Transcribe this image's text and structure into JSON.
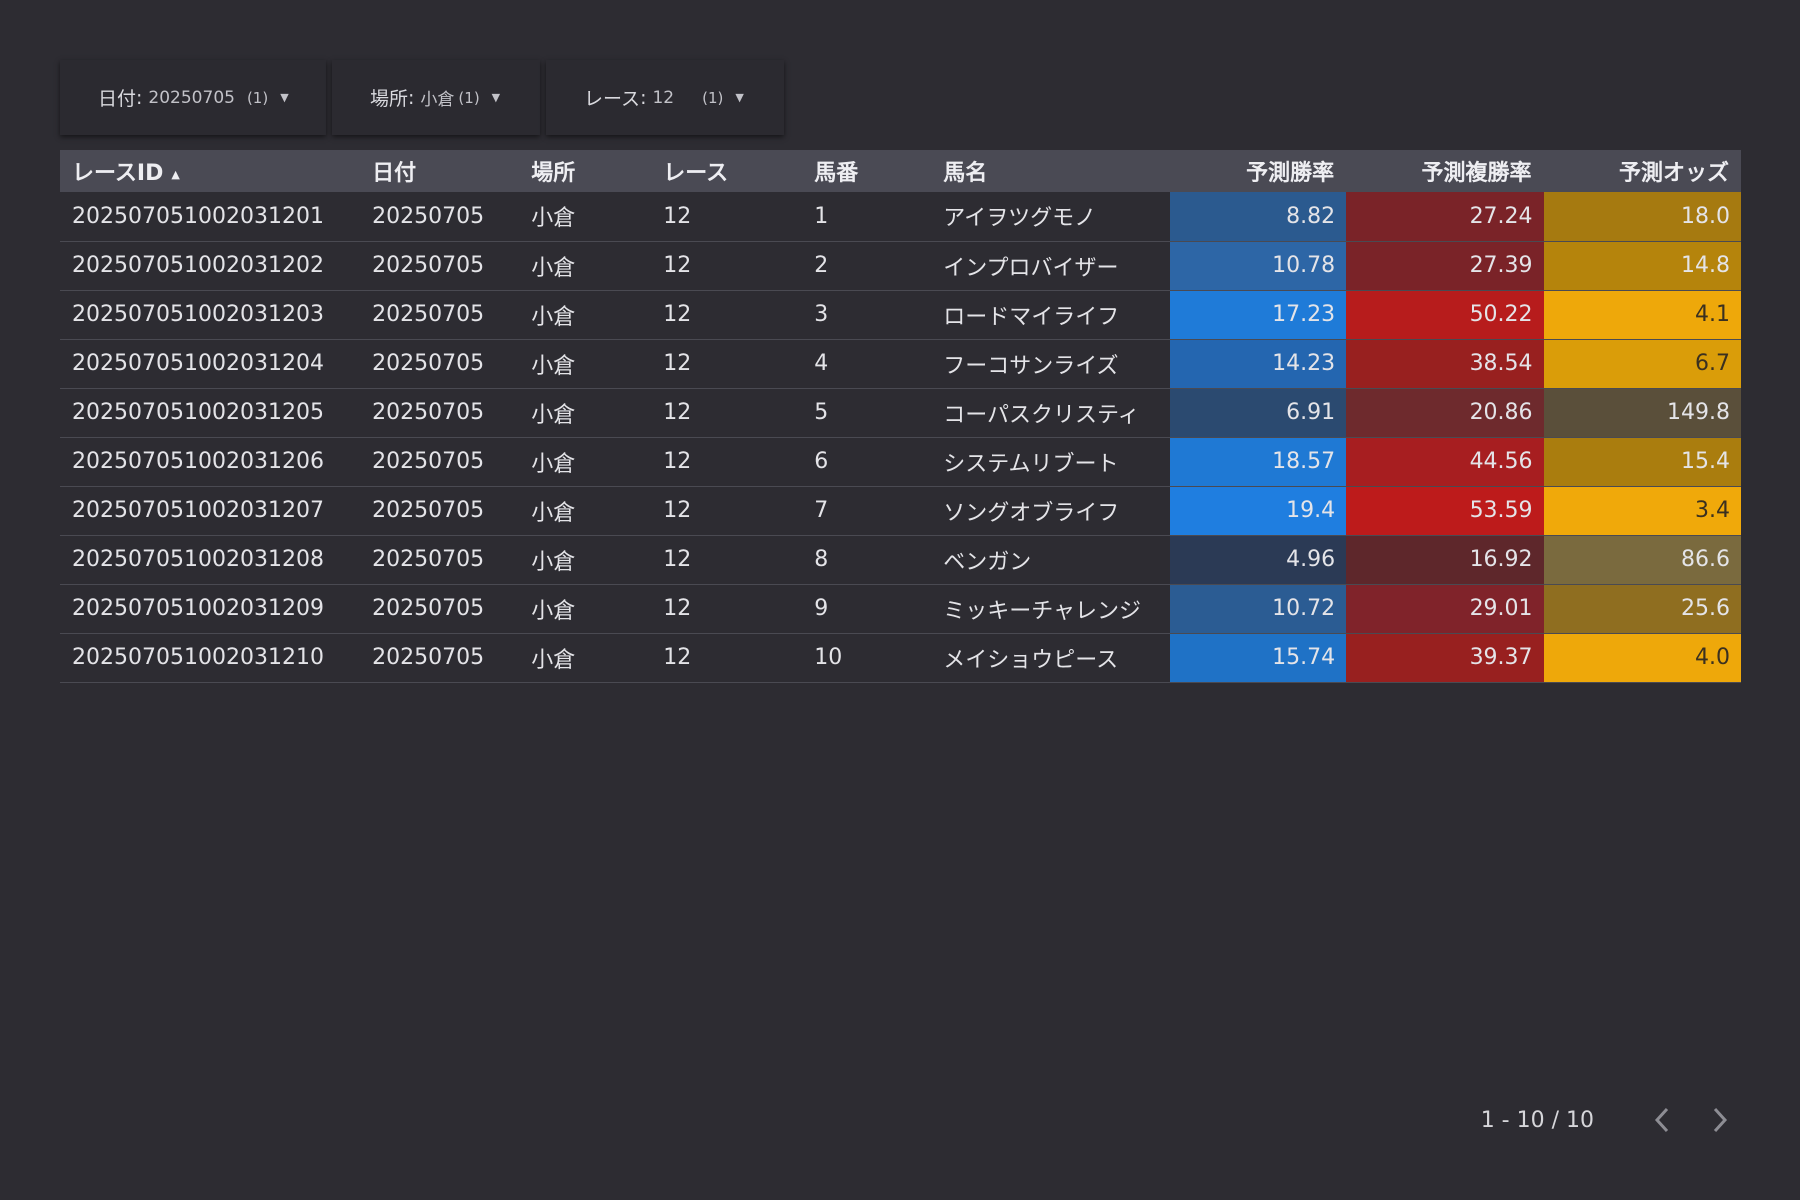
{
  "filters": [
    {
      "label": "日付",
      "value": "20250705",
      "count": "(1)"
    },
    {
      "label": "場所",
      "value": "小倉",
      "count": "(1)"
    },
    {
      "label": "レース",
      "value": "12",
      "count": "(1)"
    }
  ],
  "table": {
    "columns": [
      "レースID",
      "日付",
      "場所",
      "レース",
      "馬番",
      "馬名",
      "予測勝率",
      "予測複勝率",
      "予測オッズ"
    ],
    "sort_column": "レースID",
    "sort_direction": "ascending",
    "rows": [
      [
        "202507051002031201",
        "20250705",
        "小倉",
        "12",
        "1",
        "アイヲツグモノ",
        "8.82",
        "27.24",
        "18.0"
      ],
      [
        "202507051002031202",
        "20250705",
        "小倉",
        "12",
        "2",
        "インプロバイザー",
        "10.78",
        "27.39",
        "14.8"
      ],
      [
        "202507051002031203",
        "20250705",
        "小倉",
        "12",
        "3",
        "ロードマイライフ",
        "17.23",
        "50.22",
        "4.1"
      ],
      [
        "202507051002031204",
        "20250705",
        "小倉",
        "12",
        "4",
        "フーコサンライズ",
        "14.23",
        "38.54",
        "6.7"
      ],
      [
        "202507051002031205",
        "20250705",
        "小倉",
        "12",
        "5",
        "コーパスクリスティ",
        "6.91",
        "20.86",
        "149.8"
      ],
      [
        "202507051002031206",
        "20250705",
        "小倉",
        "12",
        "6",
        "システムリブート",
        "18.57",
        "44.56",
        "15.4"
      ],
      [
        "202507051002031207",
        "20250705",
        "小倉",
        "12",
        "7",
        "ソングオブライフ",
        "19.4",
        "53.59",
        "3.4"
      ],
      [
        "202507051002031208",
        "20250705",
        "小倉",
        "12",
        "8",
        "ベンガン",
        "4.96",
        "16.92",
        "86.6"
      ],
      [
        "202507051002031209",
        "20250705",
        "小倉",
        "12",
        "9",
        "ミッキーチャレンジ",
        "10.72",
        "29.01",
        "25.6"
      ],
      [
        "202507051002031210",
        "20250705",
        "小倉",
        "12",
        "10",
        "メイショウピース",
        "15.74",
        "39.37",
        "4.0"
      ]
    ],
    "cell_colors": {
      "win": [
        "#2b5a8f",
        "#2d66a6",
        "#1f7bd8",
        "#2466b0",
        "#2b4a70",
        "#1f79d4",
        "#1f7ee0",
        "#2b3a55",
        "#2b5c93",
        "#1f72c6"
      ],
      "place": [
        "#7a2328",
        "#7a2328",
        "#b71c1c",
        "#98201f",
        "#6e2a2d",
        "#a71e20",
        "#bd1b1b",
        "#5e272b",
        "#80232a",
        "#98201f"
      ],
      "odds": [
        "#a67a10",
        "#b5840c",
        "#eea80a",
        "#da9d09",
        "#5a4f3a",
        "#aa7d0e",
        "#f0a90a",
        "#7a6a3e",
        "#8f6e20",
        "#eea80a"
      ]
    }
  },
  "pagination": {
    "info": "1 - 10 / 10"
  }
}
